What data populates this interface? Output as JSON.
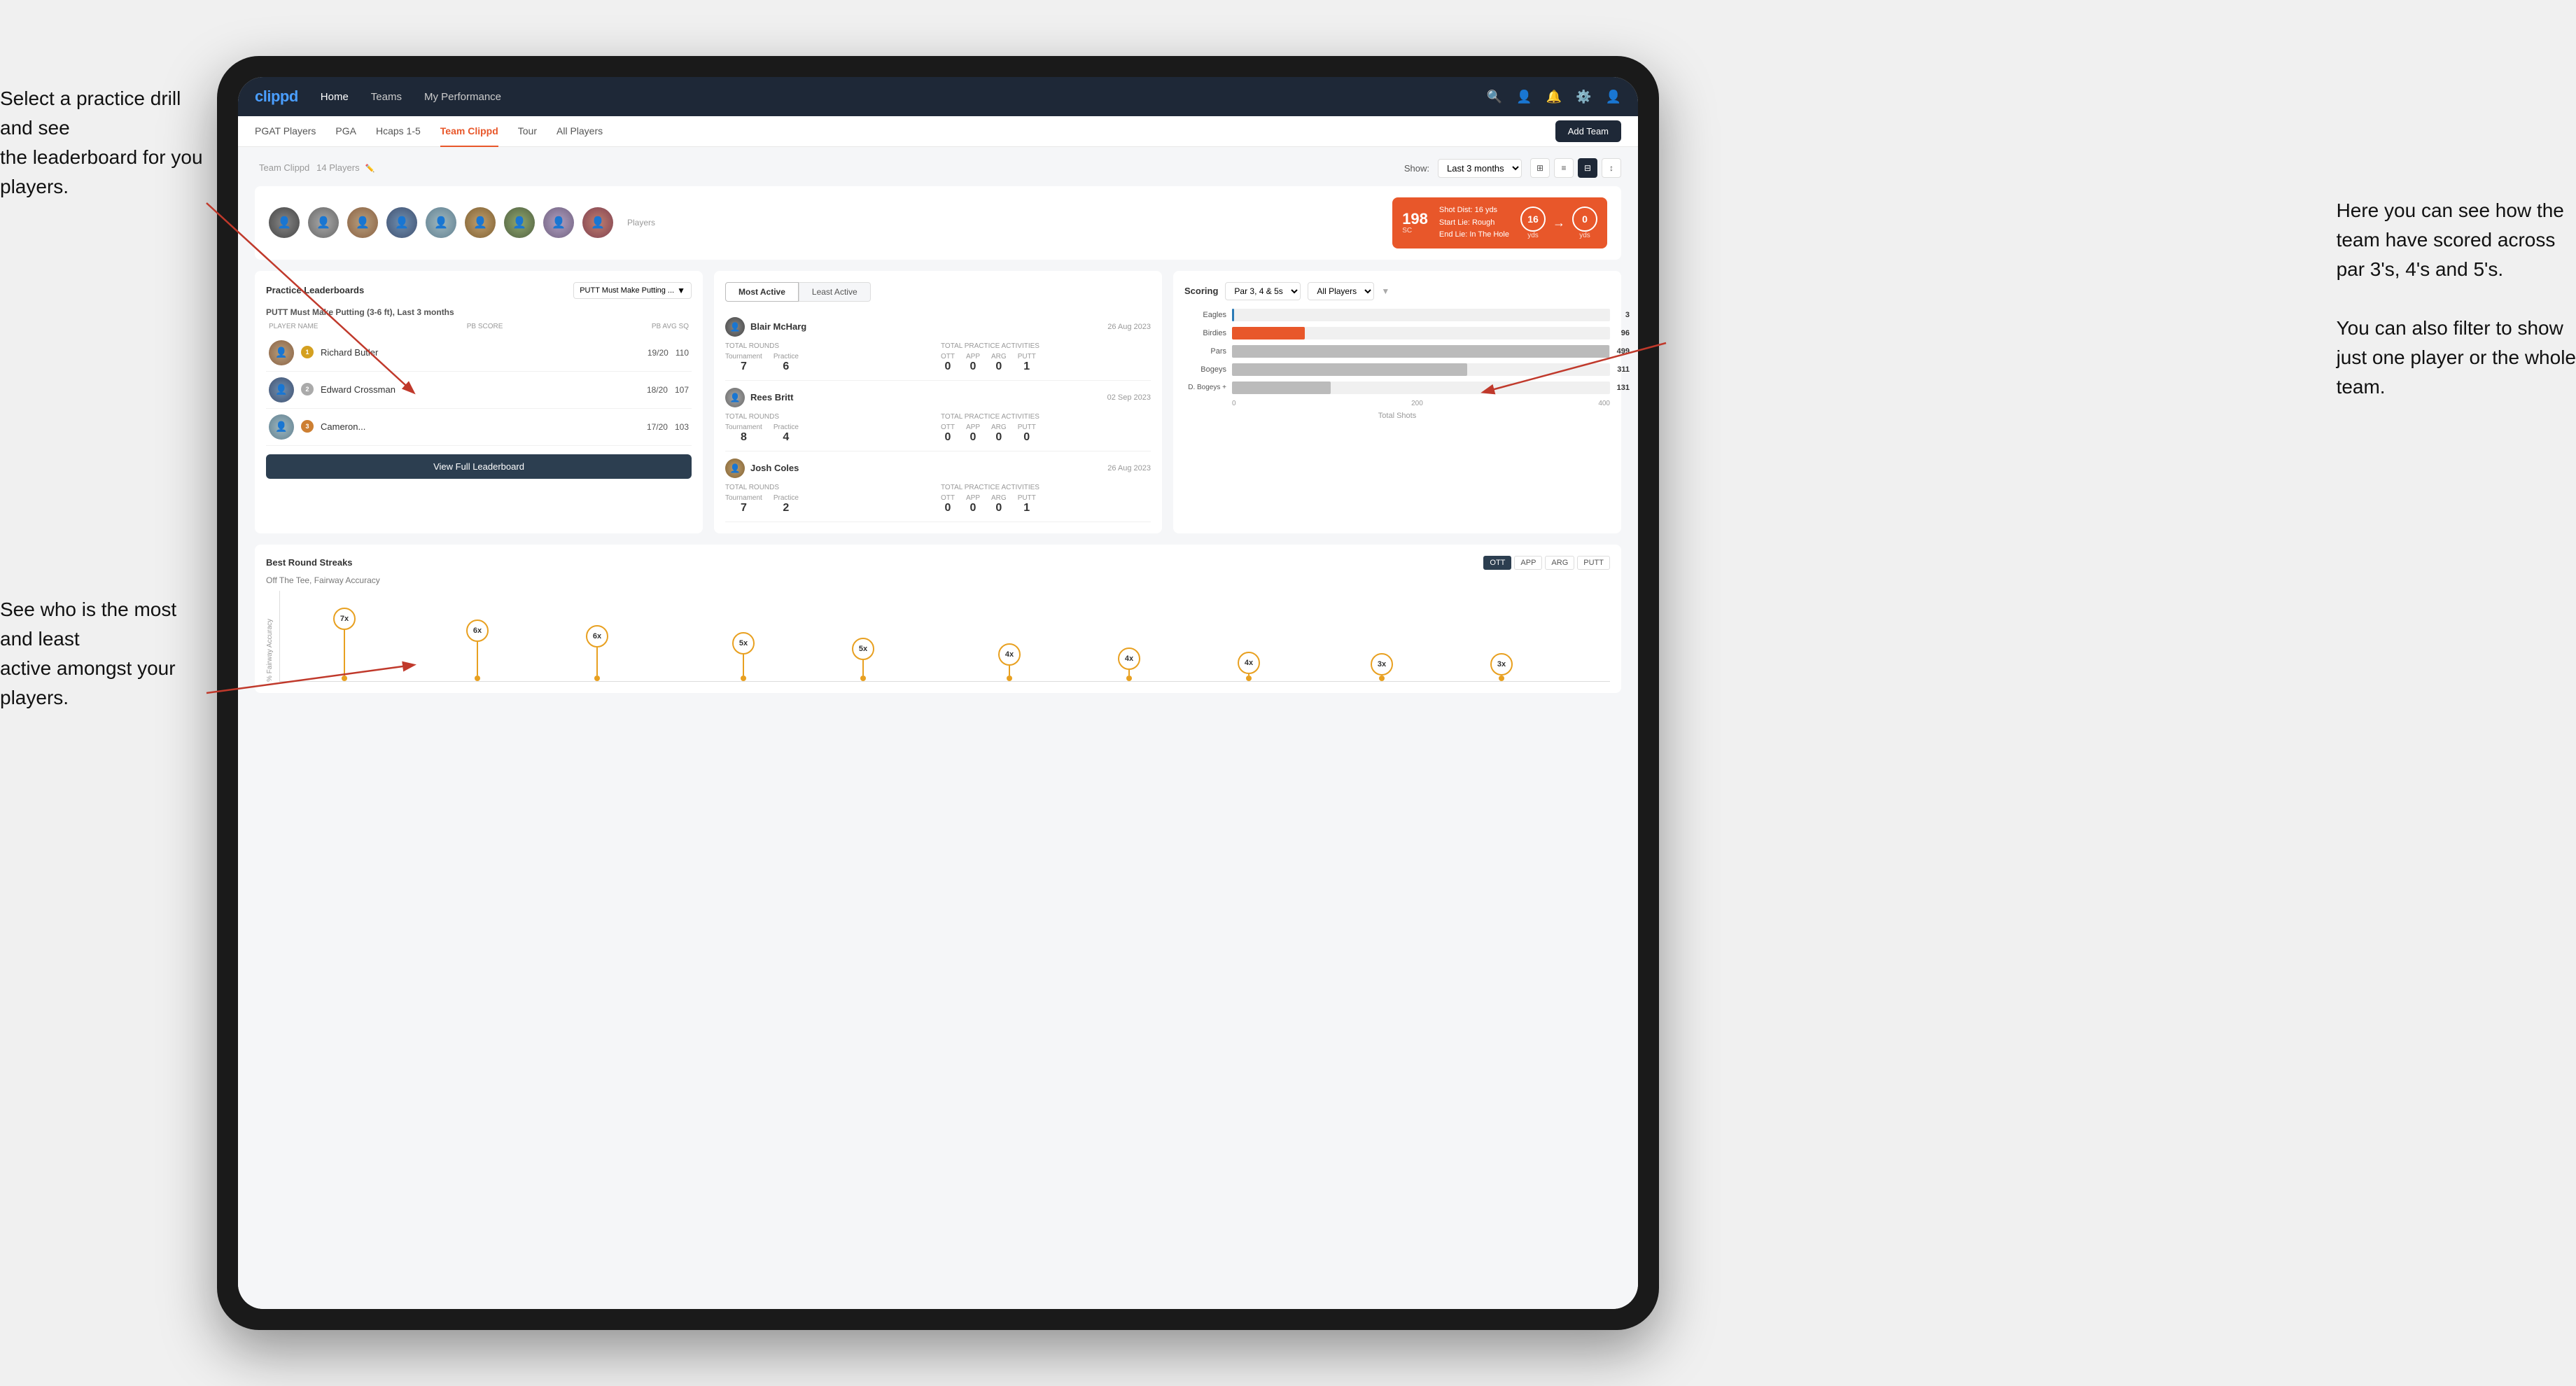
{
  "annotations": {
    "top_left": "Select a practice drill and see\nthe leaderboard for you players.",
    "bottom_left": "See who is the most and least\nactive amongst your players.",
    "right": "Here you can see how the\nteam have scored across\npar 3's, 4's and 5's.\n\nYou can also filter to show\njust one player or the whole\nteam."
  },
  "navbar": {
    "logo": "clippd",
    "items": [
      "Home",
      "Teams",
      "My Performance"
    ],
    "active": "Teams"
  },
  "subnav": {
    "items": [
      "PGAT Players",
      "PGA",
      "Hcaps 1-5",
      "Team Clippd",
      "Tour",
      "All Players"
    ],
    "active": "Team Clippd",
    "add_team_btn": "Add Team"
  },
  "team": {
    "title": "Team Clippd",
    "player_count": "14 Players",
    "show_label": "Show:",
    "show_value": "Last 3 months",
    "players_label": "Players"
  },
  "shot_card": {
    "number": "198",
    "unit": "SC",
    "shot_dist_label": "Shot Dist: 16 yds",
    "start_lie_label": "Start Lie: Rough",
    "end_lie_label": "End Lie: In The Hole",
    "yds_left": "16",
    "yds_right": "0",
    "yds_label_left": "yds",
    "yds_label_right": "yds"
  },
  "leaderboard": {
    "title": "Practice Leaderboards",
    "dropdown": "PUTT Must Make Putting ...",
    "desc_bold": "PUTT Must Make Putting (3-6 ft),",
    "desc_light": "Last 3 months",
    "col_player": "PLAYER NAME",
    "col_score": "PB SCORE",
    "col_avg": "PB AVG SQ",
    "players": [
      {
        "name": "Richard Butler",
        "score": "19/20",
        "avg": "110",
        "badge_color": "#d4a020",
        "badge_num": "1",
        "rank": 1
      },
      {
        "name": "Edward Crossman",
        "score": "18/20",
        "avg": "107",
        "badge_color": "#aaa",
        "badge_num": "2",
        "rank": 2
      },
      {
        "name": "Cameron...",
        "score": "17/20",
        "avg": "103",
        "badge_color": "#cd7f32",
        "badge_num": "3",
        "rank": 3
      }
    ],
    "view_full_btn": "View Full Leaderboard"
  },
  "activity": {
    "tab_most": "Most Active",
    "tab_least": "Least Active",
    "active_tab": "Most Active",
    "players": [
      {
        "name": "Blair McHarg",
        "date": "26 Aug 2023",
        "total_rounds_label": "Total Rounds",
        "tournament_label": "Tournament",
        "practice_label": "Practice",
        "tournament_val": "7",
        "practice_val": "6",
        "total_practice_label": "Total Practice Activities",
        "ott_val": "0",
        "app_val": "0",
        "arg_val": "0",
        "putt_val": "1"
      },
      {
        "name": "Rees Britt",
        "date": "02 Sep 2023",
        "total_rounds_label": "Total Rounds",
        "tournament_label": "Tournament",
        "practice_label": "Practice",
        "tournament_val": "8",
        "practice_val": "4",
        "total_practice_label": "Total Practice Activities",
        "ott_val": "0",
        "app_val": "0",
        "arg_val": "0",
        "putt_val": "0"
      },
      {
        "name": "Josh Coles",
        "date": "26 Aug 2023",
        "total_rounds_label": "Total Rounds",
        "tournament_label": "Tournament",
        "practice_label": "Practice",
        "tournament_val": "7",
        "practice_val": "2",
        "total_practice_label": "Total Practice Activities",
        "ott_val": "0",
        "app_val": "0",
        "arg_val": "0",
        "putt_val": "1"
      }
    ]
  },
  "scoring": {
    "title": "Scoring",
    "filter1": "Par 3, 4 & 5s",
    "filter2": "All Players",
    "bars": [
      {
        "label": "Eagles",
        "value": 3,
        "max": 500,
        "color": "#2c7bb6",
        "display": "3"
      },
      {
        "label": "Birdies",
        "value": 96,
        "max": 500,
        "color": "#e8572a",
        "display": "96"
      },
      {
        "label": "Pars",
        "value": 499,
        "max": 500,
        "color": "#bbb",
        "display": "499"
      },
      {
        "label": "Bogeys",
        "value": 311,
        "max": 500,
        "color": "#bbb",
        "display": "311"
      },
      {
        "label": "D. Bogeys +",
        "value": 131,
        "max": 500,
        "color": "#bbb",
        "display": "131"
      }
    ],
    "x_labels": [
      "0",
      "200",
      "400"
    ],
    "total_shots_label": "Total Shots"
  },
  "streaks": {
    "title": "Best Round Streaks",
    "btns": [
      "OTT",
      "APP",
      "ARG",
      "PUTT"
    ],
    "active_btn": "OTT",
    "subtitle": "Off The Tee, Fairway Accuracy",
    "y_label": "% Fairway Accuracy",
    "pins": [
      {
        "label": "7x",
        "height": 95,
        "left_pct": 4
      },
      {
        "label": "6x",
        "height": 78,
        "left_pct": 14
      },
      {
        "label": "6x",
        "height": 70,
        "left_pct": 23
      },
      {
        "label": "5x",
        "height": 60,
        "left_pct": 34
      },
      {
        "label": "5x",
        "height": 52,
        "left_pct": 43
      },
      {
        "label": "4x",
        "height": 44,
        "left_pct": 54
      },
      {
        "label": "4x",
        "height": 38,
        "left_pct": 63
      },
      {
        "label": "4x",
        "height": 32,
        "left_pct": 72
      },
      {
        "label": "3x",
        "height": 24,
        "left_pct": 82
      },
      {
        "label": "3x",
        "height": 18,
        "left_pct": 91
      }
    ]
  }
}
